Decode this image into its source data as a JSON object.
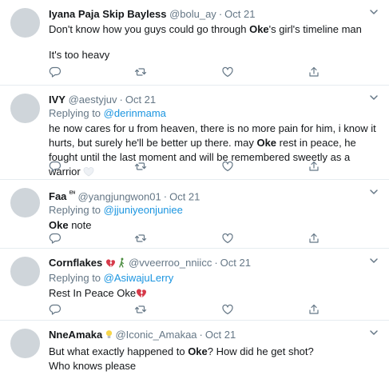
{
  "tweets": [
    {
      "name": "Iyana Paja Skip Bayless",
      "handle": "@bolu_ay",
      "dot": "·",
      "time": "Oct 21",
      "line1_a": "Don't know how you guys could go through ",
      "line1_bold": "Oke",
      "line1_b": "'s girl's timeline man",
      "line2": "It's too heavy"
    },
    {
      "name": "IVY",
      "handle": "@aestyjuv",
      "dot": "·",
      "time": "Oct 21",
      "replying": "Replying to",
      "reply_to": "@derinmama",
      "body_a": "he now cares for u from heaven, there is no more pain for him, i know it hurts, but surely he'll be better up there. may ",
      "body_bold": "Oke",
      "body_b": " rest in peace, he fought until the last moment and will be remembered sweetly as a warrior"
    },
    {
      "name": "Faa",
      "name_suffix": "ᴱᴺ",
      "handle": "@yangjungwon01",
      "dot": "·",
      "time": "Oct 21",
      "replying": "Replying to",
      "reply_to": "@jjuniyeonjuniee",
      "body_bold": "Oke",
      "body_b": " note"
    },
    {
      "name": "Cornflakes",
      "handle": "@vveerroo_nniicc",
      "dot": "·",
      "time": "Oct 21",
      "replying": "Replying to",
      "reply_to": "@AsiwajuLerry",
      "body_a": "Rest In Peace Oke"
    },
    {
      "name": "NneAmaka",
      "handle": "@Iconic_Amakaa",
      "dot": "·",
      "time": "Oct 21",
      "body_a": "But what exactly happened to ",
      "body_bold": "Oke",
      "body_b": "? How did he get shot?",
      "line2": "Who knows please"
    }
  ],
  "icons": {
    "reply": "reply-icon",
    "retweet": "retweet-icon",
    "like": "heart-icon",
    "share": "share-icon",
    "more": "chevron-down-icon"
  },
  "colors": {
    "link": "#1b95e0",
    "secondary": "#657786",
    "text": "#14171a",
    "border": "#e6ecf0"
  }
}
